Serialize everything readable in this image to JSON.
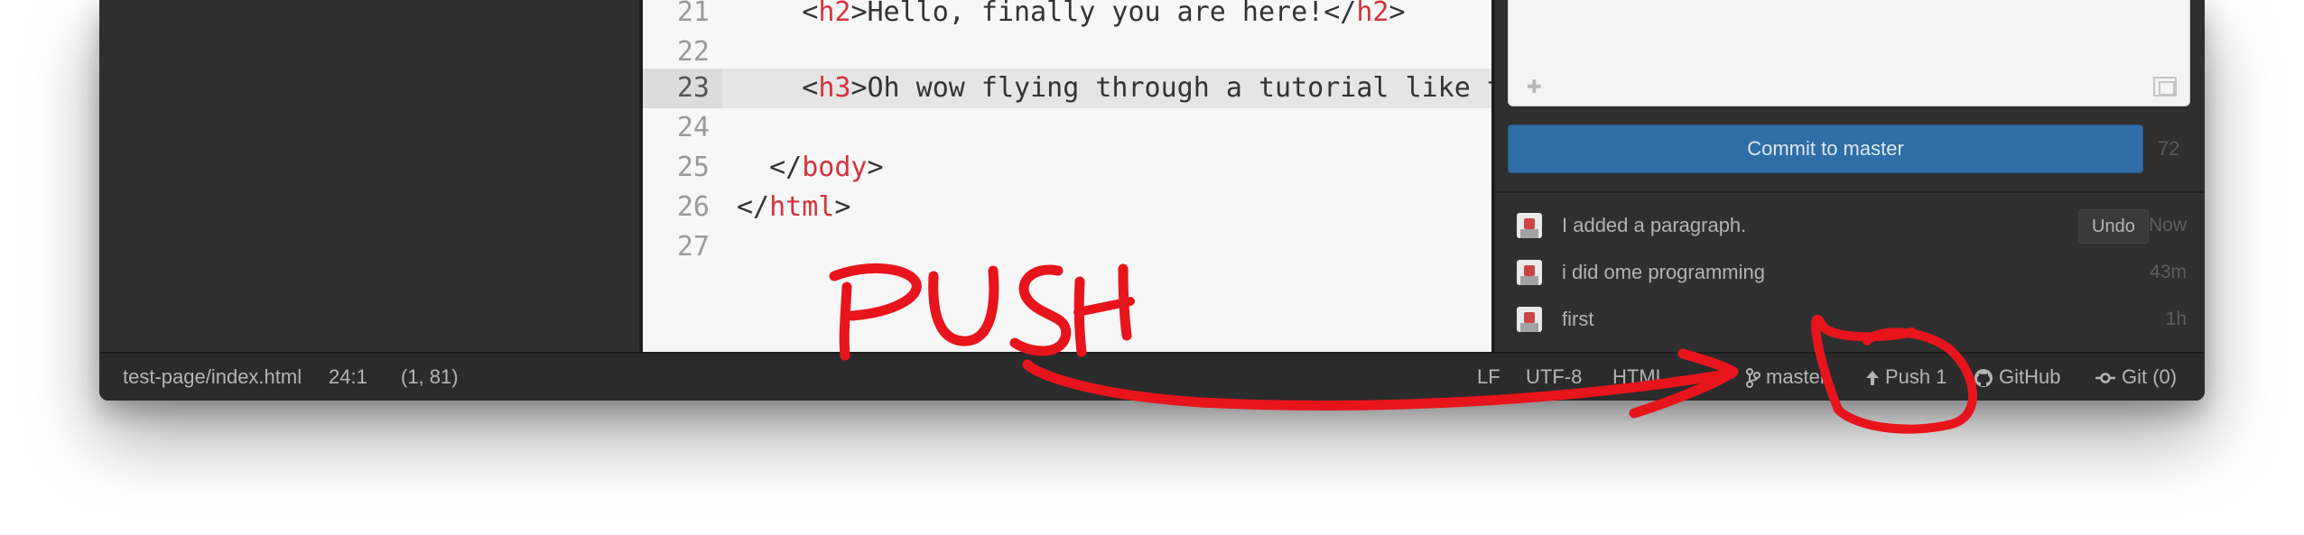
{
  "editor": {
    "lines": [
      {
        "num": "21",
        "indent": "    ",
        "open": "h2",
        "text": "Hello, finally you are here!",
        "close": "h2"
      },
      {
        "num": "22"
      },
      {
        "num": "23",
        "indent": "    ",
        "open": "h3",
        "text": "Oh wow flying through a tutorial like t",
        "close": ""
      },
      {
        "num": "24"
      },
      {
        "num": "25",
        "indent": "  ",
        "close_only": "body"
      },
      {
        "num": "26",
        "indent": "",
        "close_only": "html"
      },
      {
        "num": "27"
      }
    ]
  },
  "git_panel": {
    "commit_button": "Commit to master",
    "char_count": "72",
    "commits": [
      {
        "message": "I added a paragraph.",
        "time": "Now",
        "undo": "Undo"
      },
      {
        "message": "i did ome programming",
        "time": "43m"
      },
      {
        "message": "first",
        "time": "1h"
      }
    ]
  },
  "status_bar": {
    "file_path": "test-page/index.html",
    "cursor_pos": "24:1",
    "selection": "(1, 81)",
    "line_ending": "LF",
    "encoding": "UTF-8",
    "grammar": "HTML",
    "branch": "master",
    "push": "Push 1",
    "github": "GitHub",
    "git": "Git (0)"
  },
  "annotation": {
    "text": "PUSH",
    "color": "#e8141c"
  },
  "colors": {
    "window_bg": "#2b2b2b",
    "editor_bg": "#f7f7f7",
    "tag_color": "#d6323d",
    "commit_button": "#2f6ea7"
  }
}
